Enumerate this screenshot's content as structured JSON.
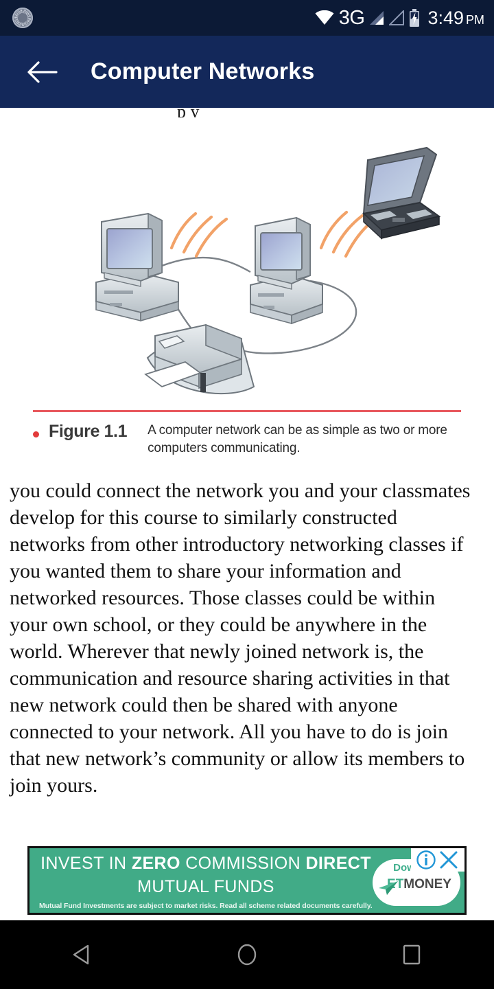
{
  "status_bar": {
    "sync_icon": "sync-progress-icon",
    "wifi_icon": "wifi-icon",
    "network_type": "3G",
    "signal_icon_1": "signal-bars-icon",
    "signal_icon_2": "signal-bars-empty-icon",
    "battery_icon": "battery-charging-icon",
    "time": "3:49",
    "meridiem": "PM",
    "background": "#0c1a36"
  },
  "app_bar": {
    "back_icon": "back-arrow-icon",
    "title": "Computer Networks",
    "background": "#13285a",
    "text_color": "#ffffff"
  },
  "content": {
    "clipped_top_line": "p y",
    "figure": {
      "illustration_alt": "network-illustration",
      "rule_color": "#e8595e",
      "bullet_color": "#e23b3b",
      "label": "Figure 1.1",
      "caption": "A computer network can be as simple as two or more computers communicating."
    },
    "paragraph": "you could connect the network you and your classmates develop for this course to similarly constructed networks from other introductory networking classes if you wanted them to share your information and networked resources. Those classes could be within your own school, or they could be anywhere in the world. Wherever that newly joined network is, the communication and resource sharing activities in that new network could then be shared with anyone connected to your network. All you have to do is join that new network’s community or allow its members to join yours."
  },
  "ad": {
    "headline_part1": "INVEST IN ",
    "headline_bold1": "ZERO",
    "headline_part2": " COMMISSION ",
    "headline_bold2": "DIRECT",
    "headline_line2": "MUTUAL FUNDS",
    "disclaimer": "Mutual Fund Investments are subject to market risks. Read all scheme related documents carefully.",
    "download_label": "Download",
    "brand_prefix": "ET",
    "brand_suffix": "MONEY",
    "info_icon": "ad-info-icon",
    "close_icon": "ad-close-icon",
    "plane_icon": "paper-plane-icon",
    "background": "#41ab87"
  },
  "nav_bar": {
    "back_icon": "nav-back-triangle-icon",
    "home_icon": "nav-home-circle-icon",
    "recents_icon": "nav-recents-square-icon",
    "background": "#000000"
  }
}
